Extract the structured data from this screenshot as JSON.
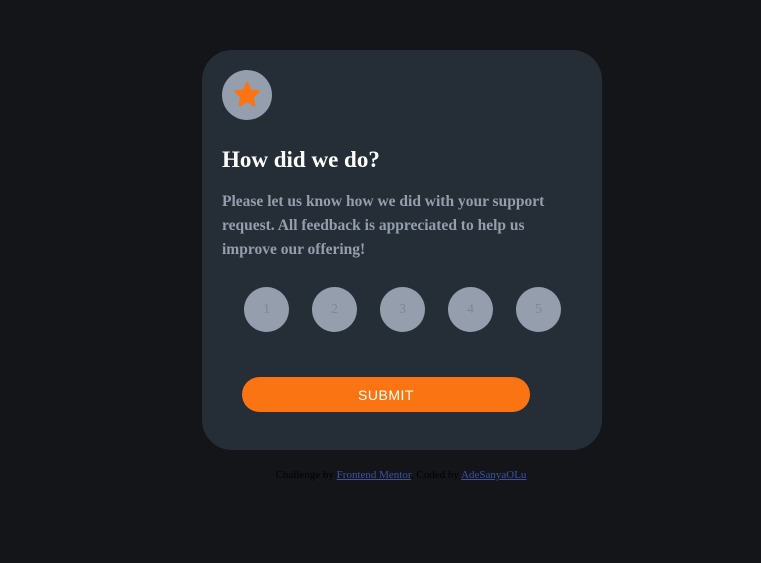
{
  "card": {
    "title": "How did we do?",
    "description": "Please let us know how we did with your support request. All feedback is appreciated to help us improve our offering!",
    "star_icon": "star-icon",
    "ratings": [
      "1",
      "2",
      "3",
      "4",
      "5"
    ],
    "submit_label": "SUBMIT"
  },
  "attribution": {
    "prefix": "Challenge by",
    "link1": "Frontend Mentor",
    "middle": ". Coded by",
    "link2": "AdeSanyaOLu"
  },
  "colors": {
    "background": "#131518",
    "card": "#252d37",
    "accent": "#fb7413",
    "muted": "#959eac"
  }
}
